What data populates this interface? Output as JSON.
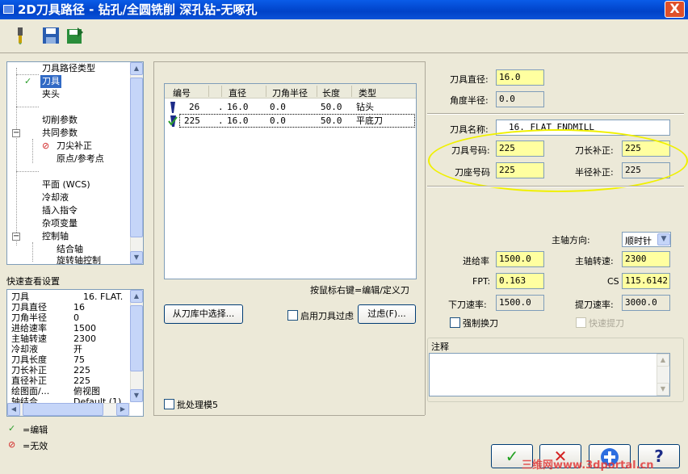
{
  "window": {
    "title": "2D刀具路径 - 钻孔/全圆铣削 深孔钻-无啄孔",
    "close_glyph": "X"
  },
  "tree": {
    "items": [
      {
        "label": "刀具路径类型"
      },
      {
        "label": "刀具",
        "checked": true,
        "selected": true
      },
      {
        "label": "夹头"
      },
      {
        "label": ""
      },
      {
        "label": "切削参数"
      },
      {
        "label": "共同参数"
      },
      {
        "label": "刀尖补正",
        "disabled": true
      },
      {
        "label": "原点/参考点"
      },
      {
        "label": ""
      },
      {
        "label": "平面 (WCS)"
      },
      {
        "label": "冷却液"
      },
      {
        "label": "插入指令"
      },
      {
        "label": "杂项变量"
      },
      {
        "label": "控制轴"
      },
      {
        "label": "结合轴"
      },
      {
        "label": "旋转轴控制"
      }
    ]
  },
  "quick_view": {
    "title": "快速查看设置",
    "rows": [
      [
        "刀具",
        "16. FLAT."
      ],
      [
        "刀具直径",
        "16"
      ],
      [
        "刀角半径",
        "0"
      ],
      [
        "进给速率",
        "1500"
      ],
      [
        "主轴转速",
        "2300"
      ],
      [
        "冷却液",
        "开"
      ],
      [
        "刀具长度",
        "75"
      ],
      [
        "刀长补正",
        "225"
      ],
      [
        "直径补正",
        "225"
      ],
      [
        "绘图面/...",
        "俯视图"
      ],
      [
        "轴结合",
        "Default (1)"
      ]
    ]
  },
  "legend": {
    "edit": "=编辑",
    "invalid": "=无效"
  },
  "tool_table": {
    "headers": [
      "编号",
      "",
      "直径",
      "刀角半径",
      "长度",
      "类型"
    ],
    "rows": [
      {
        "num": "26",
        "dot": ".",
        "dia": "16.0",
        "corner": "0.0",
        "len": "50.0",
        "type": "钻头"
      },
      {
        "num": "225",
        "dot": ".",
        "dia": "16.0",
        "corner": "0.0",
        "len": "50.0",
        "type": "平底刀"
      }
    ],
    "hint": "按鼠标右键=编辑/定义刀"
  },
  "buttons": {
    "from_library": "从刀库中选择...",
    "enable_filter": "启用刀具过虑",
    "filter": "过虑(F)...",
    "batch": "批处理模5"
  },
  "params": {
    "tool_diameter_label": "刀具直径:",
    "tool_diameter": "16.0",
    "corner_radius_label": "角度半径:",
    "corner_radius": "0.0",
    "tool_name_label": "刀具名称:",
    "tool_name": "16. FLAT ENDMILL",
    "tool_number_label": "刀具号码:",
    "tool_number": "225",
    "length_offset_label": "刀长补正:",
    "length_offset": "225",
    "holder_number_label": "刀座号码",
    "holder_number": "225",
    "radius_offset_label": "半径补正:",
    "radius_offset": "225",
    "spindle_dir_label": "主轴方向:",
    "spindle_dir": "顺时针",
    "feed_rate_label": "进给率",
    "feed_rate": "1500.0",
    "spindle_speed_label": "主轴转速:",
    "spindle_speed": "2300",
    "fpt_label": "FPT:",
    "fpt": "0.163",
    "cs_label": "CS",
    "cs": "115.6142",
    "plunge_label": "下刀速率:",
    "plunge": "1500.0",
    "retract_label": "提刀速率:",
    "retract": "3000.0",
    "force_change_label": "强制换刀",
    "rapid_retract_label": "快速提刀",
    "comment_label": "注释"
  },
  "watermark": "三维网www.3dportal.cn"
}
